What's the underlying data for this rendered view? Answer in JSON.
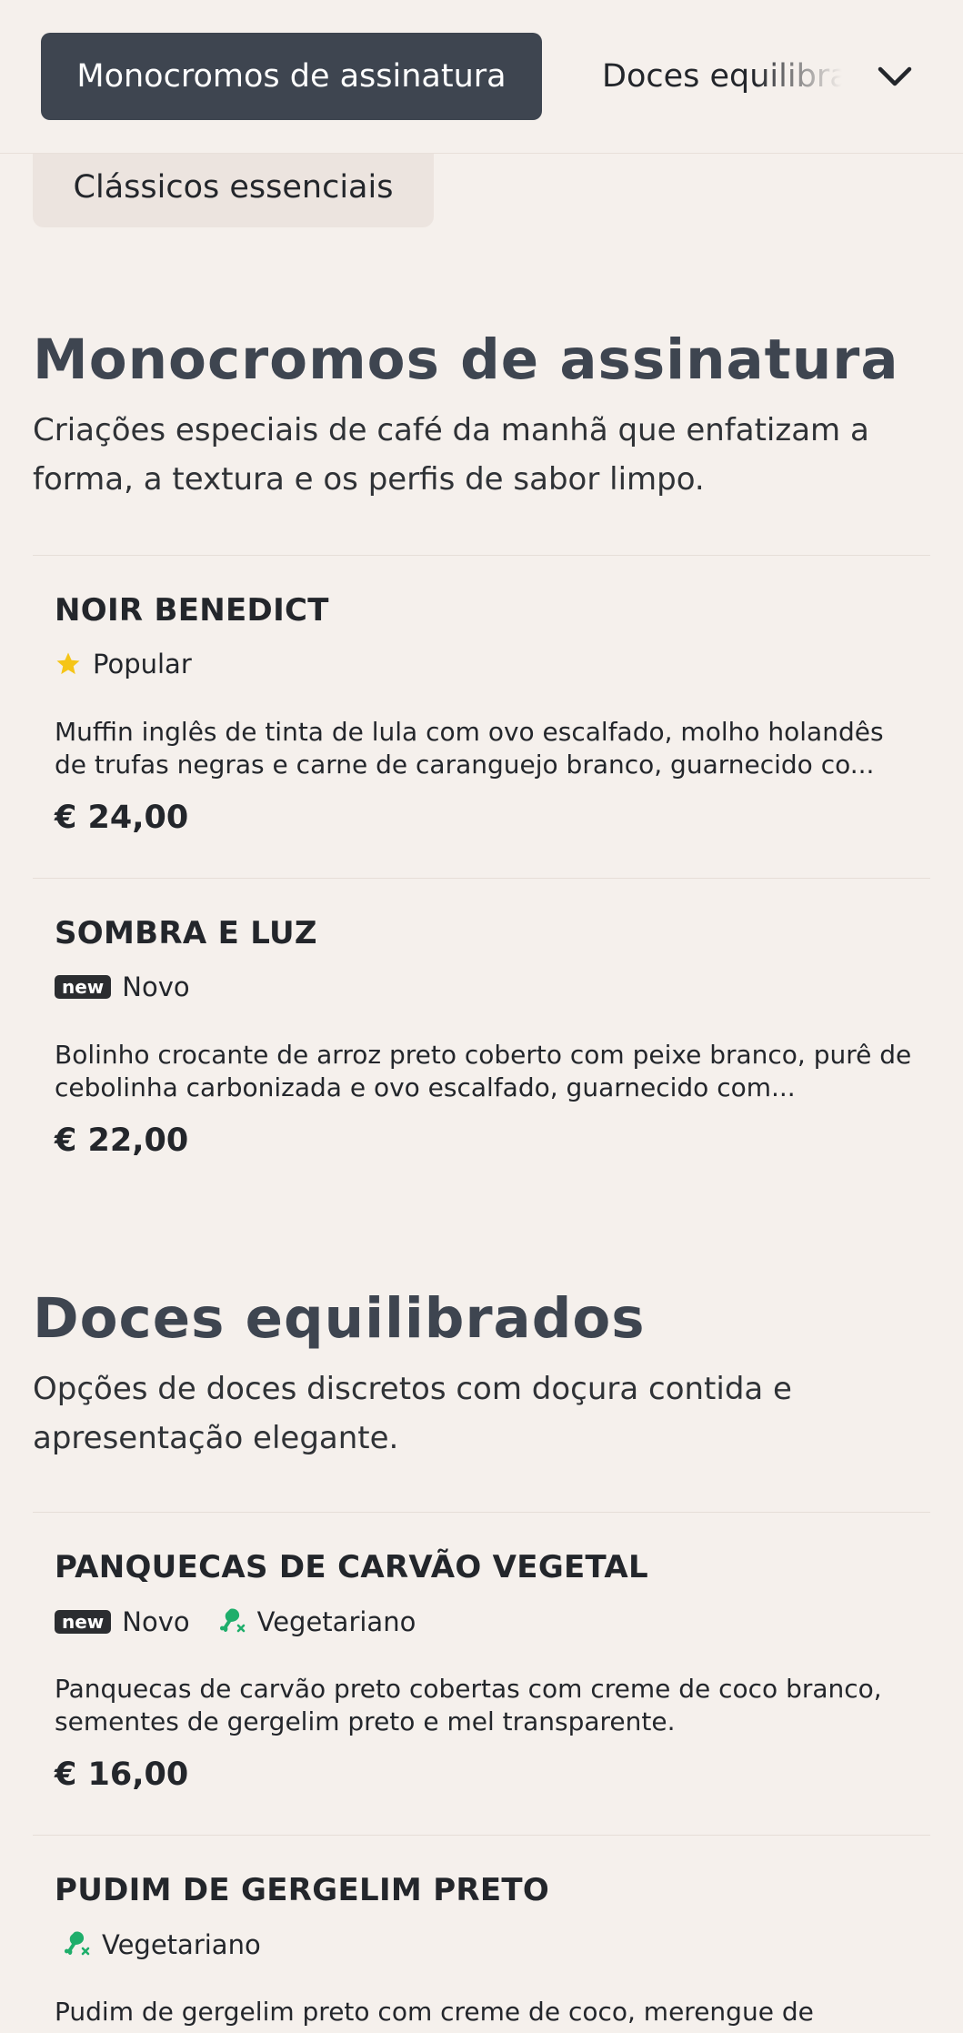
{
  "nav": {
    "active_tab": "Monocromos de assinatura",
    "next_tab": "Doces equilibrados",
    "second_row_tab": "Clássicos essenciais"
  },
  "sections": [
    {
      "title": "Monocromos de assinatura",
      "description": "Criações especiais de café da manhã que enfatizam a forma, a textura e os perfis de sabor limpo.",
      "items": [
        {
          "name": "NOIR BENEDICT",
          "tag_popular": "Popular",
          "description": "Muffin inglês de tinta de lula com ovo escalfado, molho holandês de trufas negras e carne de caranguejo branco, guarnecido co...",
          "price": "€ 24,00"
        },
        {
          "name": "SOMBRA E LUZ",
          "badge_new": "new",
          "tag_new": "Novo",
          "description": "Bolinho crocante de arroz preto coberto com peixe branco, purê de cebolinha carbonizada e ovo escalfado, guarnecido com...",
          "price": "€ 22,00"
        }
      ]
    },
    {
      "title": "Doces equilibrados",
      "description": "Opções de doces discretos com doçura contida e apresentação elegante.",
      "items": [
        {
          "name": "PANQUECAS DE CARVÃO VEGETAL",
          "badge_new": "new",
          "tag_new": "Novo",
          "tag_veg": "Vegetariano",
          "description": "Panquecas de carvão preto cobertas com creme de coco branco, sementes de gergelim preto e mel transparente.",
          "price": "€ 16,00"
        },
        {
          "name": "PUDIM DE GERGELIM PRETO",
          "tag_veg": "Vegetariano",
          "description": "Pudim de gergelim preto com creme de coco, merengue de",
          "price": ""
        }
      ]
    }
  ],
  "colors": {
    "background": "#f5f0ec",
    "active_tab": "#3e4550",
    "heading": "#3e4550",
    "star": "#f5c518",
    "vegetarian": "#1fae6b"
  },
  "icons": {
    "chevron": "chevron-down-icon",
    "popular": "star-icon",
    "vegetarian": "no-meat-icon"
  }
}
